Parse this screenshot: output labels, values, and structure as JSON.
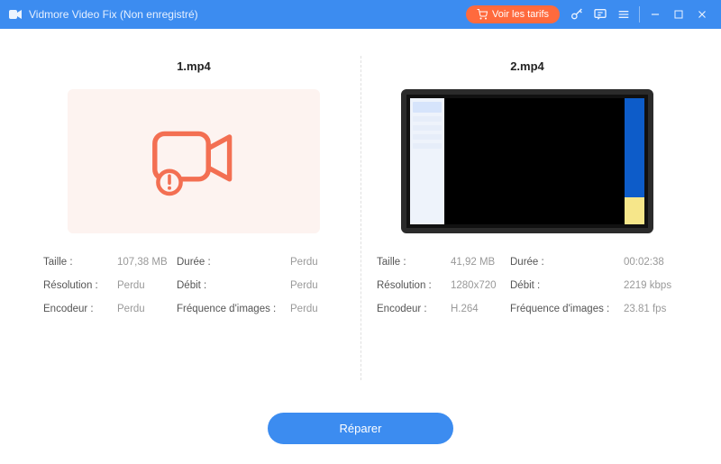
{
  "titlebar": {
    "app_title": "Vidmore Video Fix (Non enregistré)",
    "tarifs_label": "Voir les tarifs"
  },
  "left": {
    "filename": "1.mp4",
    "info": {
      "size_label": "Taille :",
      "size_value": "107,38 MB",
      "duration_label": "Durée :",
      "duration_value": "Perdu",
      "resolution_label": "Résolution :",
      "resolution_value": "Perdu",
      "bitrate_label": "Débit :",
      "bitrate_value": "Perdu",
      "encoder_label": "Encodeur :",
      "encoder_value": "Perdu",
      "fps_label": "Fréquence d'images :",
      "fps_value": "Perdu"
    }
  },
  "right": {
    "filename": "2.mp4",
    "info": {
      "size_label": "Taille :",
      "size_value": "41,92 MB",
      "duration_label": "Durée :",
      "duration_value": "00:02:38",
      "resolution_label": "Résolution :",
      "resolution_value": "1280x720",
      "bitrate_label": "Débit :",
      "bitrate_value": "2219 kbps",
      "encoder_label": "Encodeur :",
      "encoder_value": "H.264",
      "fps_label": "Fréquence d'images :",
      "fps_value": "23.81 fps"
    }
  },
  "footer": {
    "repair_label": "Réparer"
  }
}
